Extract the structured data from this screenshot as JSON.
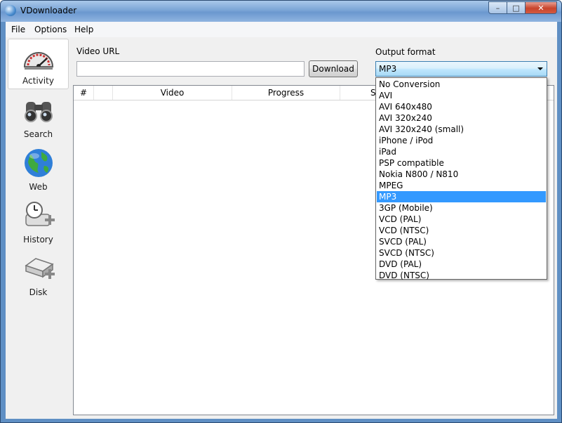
{
  "window": {
    "title": "VDownloader",
    "minimize_glyph": "–",
    "maximize_glyph": "□",
    "close_glyph": "✕"
  },
  "menu": [
    "File",
    "Options",
    "Help"
  ],
  "sidebar": {
    "items": [
      {
        "label": "Activity",
        "icon": "speedometer-icon",
        "active": true
      },
      {
        "label": "Search",
        "icon": "binoculars-icon",
        "active": false
      },
      {
        "label": "Web",
        "icon": "globe-icon",
        "active": false
      },
      {
        "label": "History",
        "icon": "clock-add-icon",
        "active": false
      },
      {
        "label": "Disk",
        "icon": "disk-add-icon",
        "active": false
      }
    ]
  },
  "url": {
    "label": "Video URL",
    "value": ""
  },
  "download_button": "Download",
  "format": {
    "label": "Output format",
    "selected": "MP3",
    "options": [
      "No Conversion",
      "AVI",
      "AVI 640x480",
      "AVI 320x240",
      "AVI 320x240 (small)",
      "iPhone / iPod",
      "iPad",
      "PSP compatible",
      "Nokia N800 / N810",
      "MPEG",
      "MP3",
      "3GP (Mobile)",
      "VCD (PAL)",
      "VCD (NTSC)",
      "SVCD (PAL)",
      "SVCD (NTSC)",
      "DVD (PAL)",
      "DVD (NTSC)"
    ]
  },
  "table": {
    "columns": [
      "#",
      "",
      "Video",
      "Progress",
      "S"
    ]
  },
  "colors": {
    "selection": "#3399ff",
    "frame": "#5f8fc4"
  }
}
